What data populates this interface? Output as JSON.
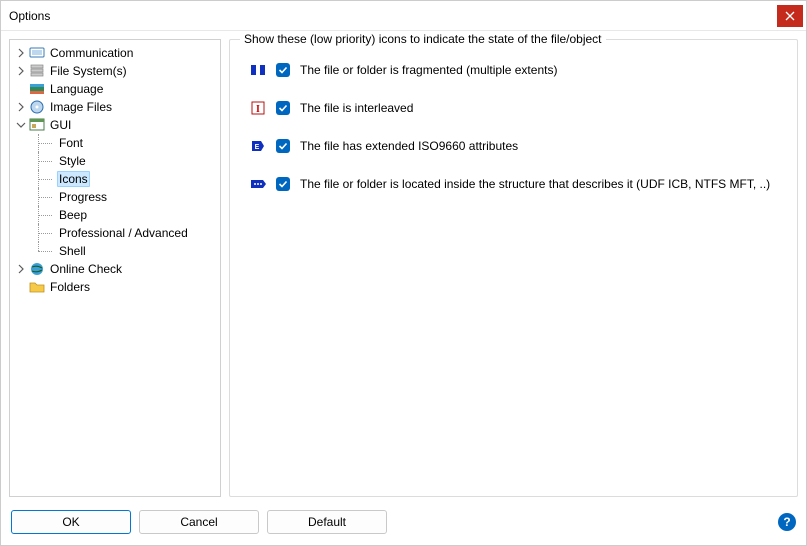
{
  "window": {
    "title": "Options"
  },
  "tree": {
    "communication": "Communication",
    "filesystems": "File System(s)",
    "language": "Language",
    "imagefiles": "Image Files",
    "gui": "GUI",
    "gui_children": {
      "font": "Font",
      "style": "Style",
      "icons": "Icons",
      "progress": "Progress",
      "beep": "Beep",
      "professional": "Professional / Advanced",
      "shell": "Shell"
    },
    "onlinecheck": "Online Check",
    "folders": "Folders"
  },
  "panel": {
    "legend": "Show these (low priority) icons to indicate the state of the file/object",
    "opt_fragmented": "The file or folder is fragmented (multiple extents)",
    "opt_interleaved": "The file is interleaved",
    "opt_iso9660": "The file has extended ISO9660 attributes",
    "opt_inside": "The file or folder is located inside the structure that describes it (UDF ICB, NTFS MFT, ..)"
  },
  "buttons": {
    "ok": "OK",
    "cancel": "Cancel",
    "default": "Default",
    "help": "?"
  }
}
